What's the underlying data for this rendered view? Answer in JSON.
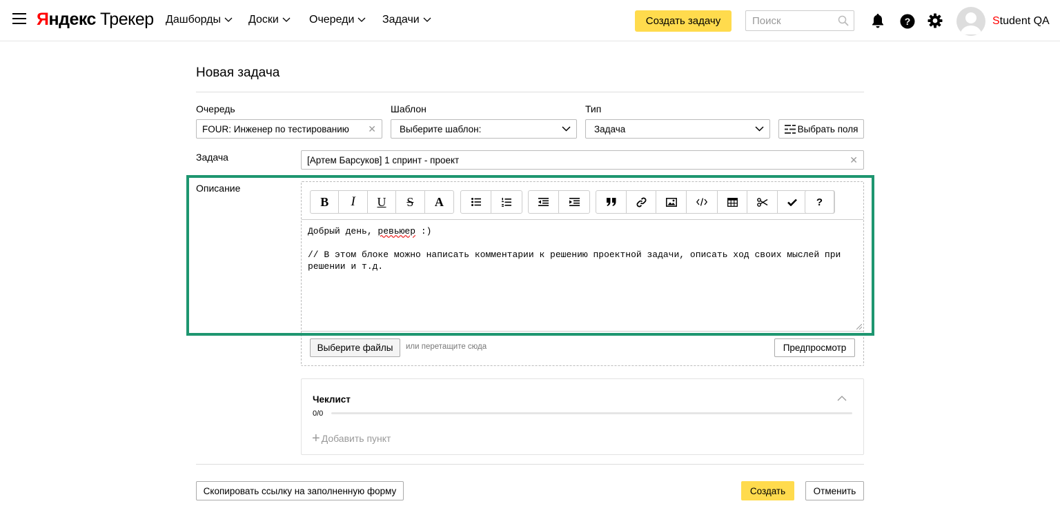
{
  "header": {
    "logo_brand_first": "Я",
    "logo_brand_rest": "ндекс",
    "logo_product": "Трекер",
    "nav": [
      {
        "label": "Дашборды"
      },
      {
        "label": "Доски"
      },
      {
        "label": "Очереди"
      },
      {
        "label": "Задачи"
      }
    ],
    "create_task_label": "Создать задачу",
    "search_placeholder": "Поиск",
    "user_name_first_letter": "S",
    "user_name_rest": "tudent QA",
    "icons": [
      "menu-icon",
      "chevron-down-icon",
      "search-icon",
      "bell-icon",
      "help-icon",
      "gear-icon",
      "avatar"
    ]
  },
  "form": {
    "title": "Новая задача",
    "queue": {
      "label": "Очередь",
      "value": "FOUR: Инженер по тестированию"
    },
    "template": {
      "label": "Шаблон",
      "value": "Выберите шаблон:"
    },
    "type": {
      "label": "Тип",
      "value": "Задача"
    },
    "choose_fields_label": "Выбрать поля",
    "summary": {
      "label": "Задача",
      "value": "[Артем Барсуков] 1 спринт - проект"
    },
    "description": {
      "label": "Описание",
      "text_line1_before": "Добрый день, ",
      "text_line1_spell": "ревьюер",
      "text_line1_after": " :)",
      "text_body": "// В этом блоке можно написать комментарии к решению проектной задачи, описать ход своих мыслей при решении и т.д."
    },
    "toolbar": {
      "bold_glyph": "B",
      "italic_glyph": "I",
      "underline_glyph": "U",
      "strike_glyph": "S",
      "font_glyph": "A",
      "help_glyph": "?"
    },
    "attachments": {
      "choose_files_label": "Выберите файлы",
      "drop_hint": "или перетащите сюда",
      "preview_label": "Предпросмотр"
    },
    "checklist": {
      "title": "Чеклист",
      "count": "0/0",
      "progress": 0,
      "add_item_label": "Добавить пункт"
    },
    "copy_link_label": "Скопировать ссылку на заполненную форму",
    "submit_label": "Создать",
    "cancel_label": "Отменить"
  },
  "colors": {
    "accent_yellow": "#ffdb4d",
    "highlight_green": "#1e9670",
    "logo_red": "#ff0000"
  }
}
